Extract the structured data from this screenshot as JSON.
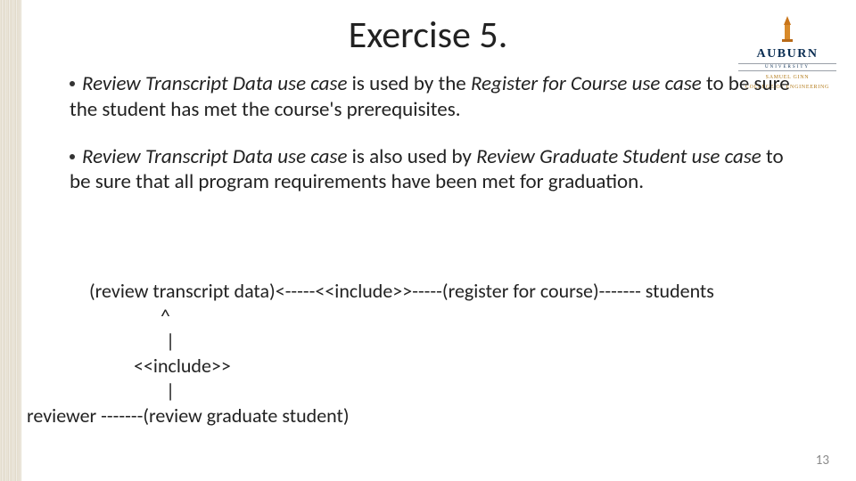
{
  "title": "Exercise 5.",
  "logo": {
    "word": "AUBURN",
    "sub": "UNIVERSITY",
    "college1": "SAMUEL GINN",
    "college2": "COLLEGE OF ENGINEERING"
  },
  "bullets": {
    "b1": {
      "s1": "Review Transcript Data use case",
      "s2": " is used by the ",
      "s3": "Register for Course use case",
      "s4": " to be sure the student has met the course's prerequisites."
    },
    "b2": {
      "s1": "Review Transcript Data use case",
      "s2": " is also used by ",
      "s3": "Review Graduate Student use case",
      "s4": " to be sure that all program  requirements have been met for graduation."
    }
  },
  "diagram": {
    "l1": "(review transcript data)<-----<<include>>-----(register for course)------- students",
    "l2": "^",
    "l3": "|",
    "l4": "<<include>>",
    "l5": "|",
    "l6": "reviewer -------(review graduate student)"
  },
  "page_number": "13"
}
